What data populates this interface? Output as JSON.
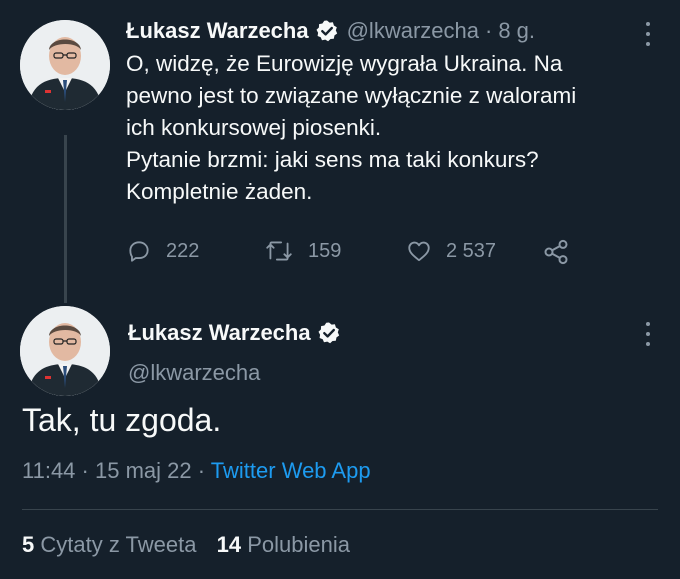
{
  "colors": {
    "background": "#15202b",
    "text_primary": "#f7f9f9",
    "text_secondary": "#8b98a5",
    "accent": "#1d9bf0",
    "divider": "#38444d"
  },
  "tweet1": {
    "author_name": "Łukasz Warzecha",
    "handle": "@lkwarzecha",
    "separator": "·",
    "time_ago": "8 g.",
    "text_lines": [
      "O, widzę, że Eurowizję wygrała Ukraina. Na",
      "pewno jest to związane wyłącznie z walorami",
      "ich konkursowej piosenki.",
      "Pytanie brzmi: jaki sens ma taki konkurs?",
      "Kompletnie żaden."
    ],
    "replies": "222",
    "retweets": "159",
    "likes": "2 537",
    "icons": [
      "reply-icon",
      "retweet-icon",
      "like-icon",
      "share-icon",
      "verified-icon",
      "more-icon"
    ]
  },
  "tweet2": {
    "author_name": "Łukasz Warzecha",
    "handle": "@lkwarzecha",
    "text": "Tak, tu zgoda.",
    "time": "11:44",
    "sep1": "·",
    "date": "15 maj 22",
    "sep2": "·",
    "app": "Twitter Web App",
    "quote_count": "5",
    "quote_label": "Cytaty z Tweeta",
    "like_count": "14",
    "like_label": "Polubienia"
  }
}
